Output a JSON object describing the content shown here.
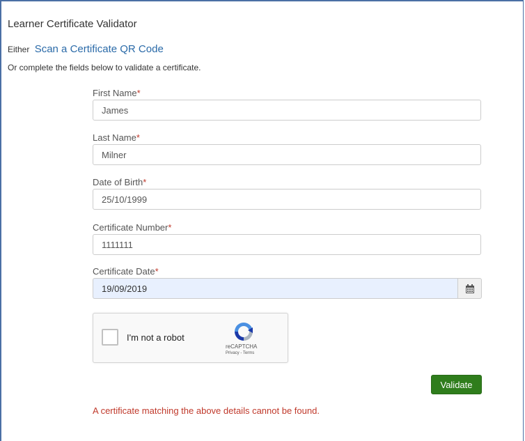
{
  "page": {
    "title": "Learner Certificate Validator",
    "either_prefix": "Either",
    "scan_link": "Scan a Certificate QR Code",
    "instructions": "Or complete the fields below to validate a certificate."
  },
  "form": {
    "required_marker": "*",
    "first_name": {
      "label": "First Name",
      "value": "James"
    },
    "last_name": {
      "label": "Last Name",
      "value": "Milner"
    },
    "date_of_birth": {
      "label": "Date of Birth",
      "value": "25/10/1999"
    },
    "certificate_number": {
      "label": "Certificate Number",
      "value": "1111111"
    },
    "certificate_date": {
      "label": "Certificate Date",
      "value": "19/09/2019",
      "icon": "calendar-icon"
    }
  },
  "captcha": {
    "label": "I'm not a robot",
    "brand": "reCAPTCHA",
    "privacy": "Privacy",
    "separator": " - ",
    "terms": "Terms",
    "icon": "recaptcha-logo-icon"
  },
  "actions": {
    "validate_label": "Validate"
  },
  "error": {
    "message": "A certificate matching the above details cannot be found."
  },
  "colors": {
    "link": "#2a6aa8",
    "required": "#c0392b",
    "error": "#c0392b",
    "validate_button": "#2f7d1c",
    "autofill_background": "#e8f0fe",
    "frame_border": "#4a6fa5"
  }
}
